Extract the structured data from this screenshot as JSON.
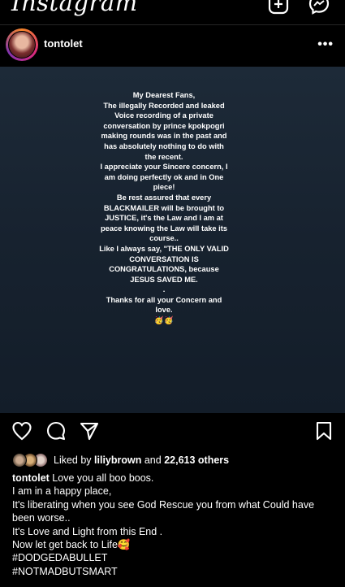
{
  "app": {
    "title": "Instagram",
    "icons": [
      "new-post-icon",
      "messenger-icon"
    ]
  },
  "post": {
    "username": "tontolet",
    "more_label": "•••",
    "image_text": "My Dearest Fans,\nThe illegally Recorded and leaked Voice recording of a private conversation by prince kpokpogri making rounds was in the past and has absolutely nothing to do with the recent.\nI appreciate your Sincere concern, I am doing perfectly ok and in One piece!\nBe rest assured that every BLACKMAILER will be brought to JUSTICE, it's the Law and I am at peace knowing the Law will take its course..\nLike I always say, \"THE ONLY VALID CONVERSATION IS CONGRATULATIONS, because JESUS SAVED ME.\n.\nThanks for all your Concern and love.\n🥳🥳",
    "actions": [
      "heart-icon",
      "comment-icon",
      "share-icon",
      "bookmark-icon"
    ],
    "likes": {
      "prefix": "Liked by ",
      "user": "liliybrown",
      "middle": " and ",
      "count": "22,613 others"
    },
    "caption": {
      "username": "tontolet",
      "first_line": " Love you all boo boos.",
      "lines": [
        "I am in a happy place,",
        "It's liberating when you see God Rescue you from what Could have been worse..",
        "It's Love and Light from this End .",
        "Now let get back to Life🥰",
        "#DODGEDABULLET",
        "#NOTMADBUTSMART"
      ]
    }
  },
  "colors": {
    "background": "#000000",
    "image_bg": "#17222f",
    "divider": "#262626"
  }
}
